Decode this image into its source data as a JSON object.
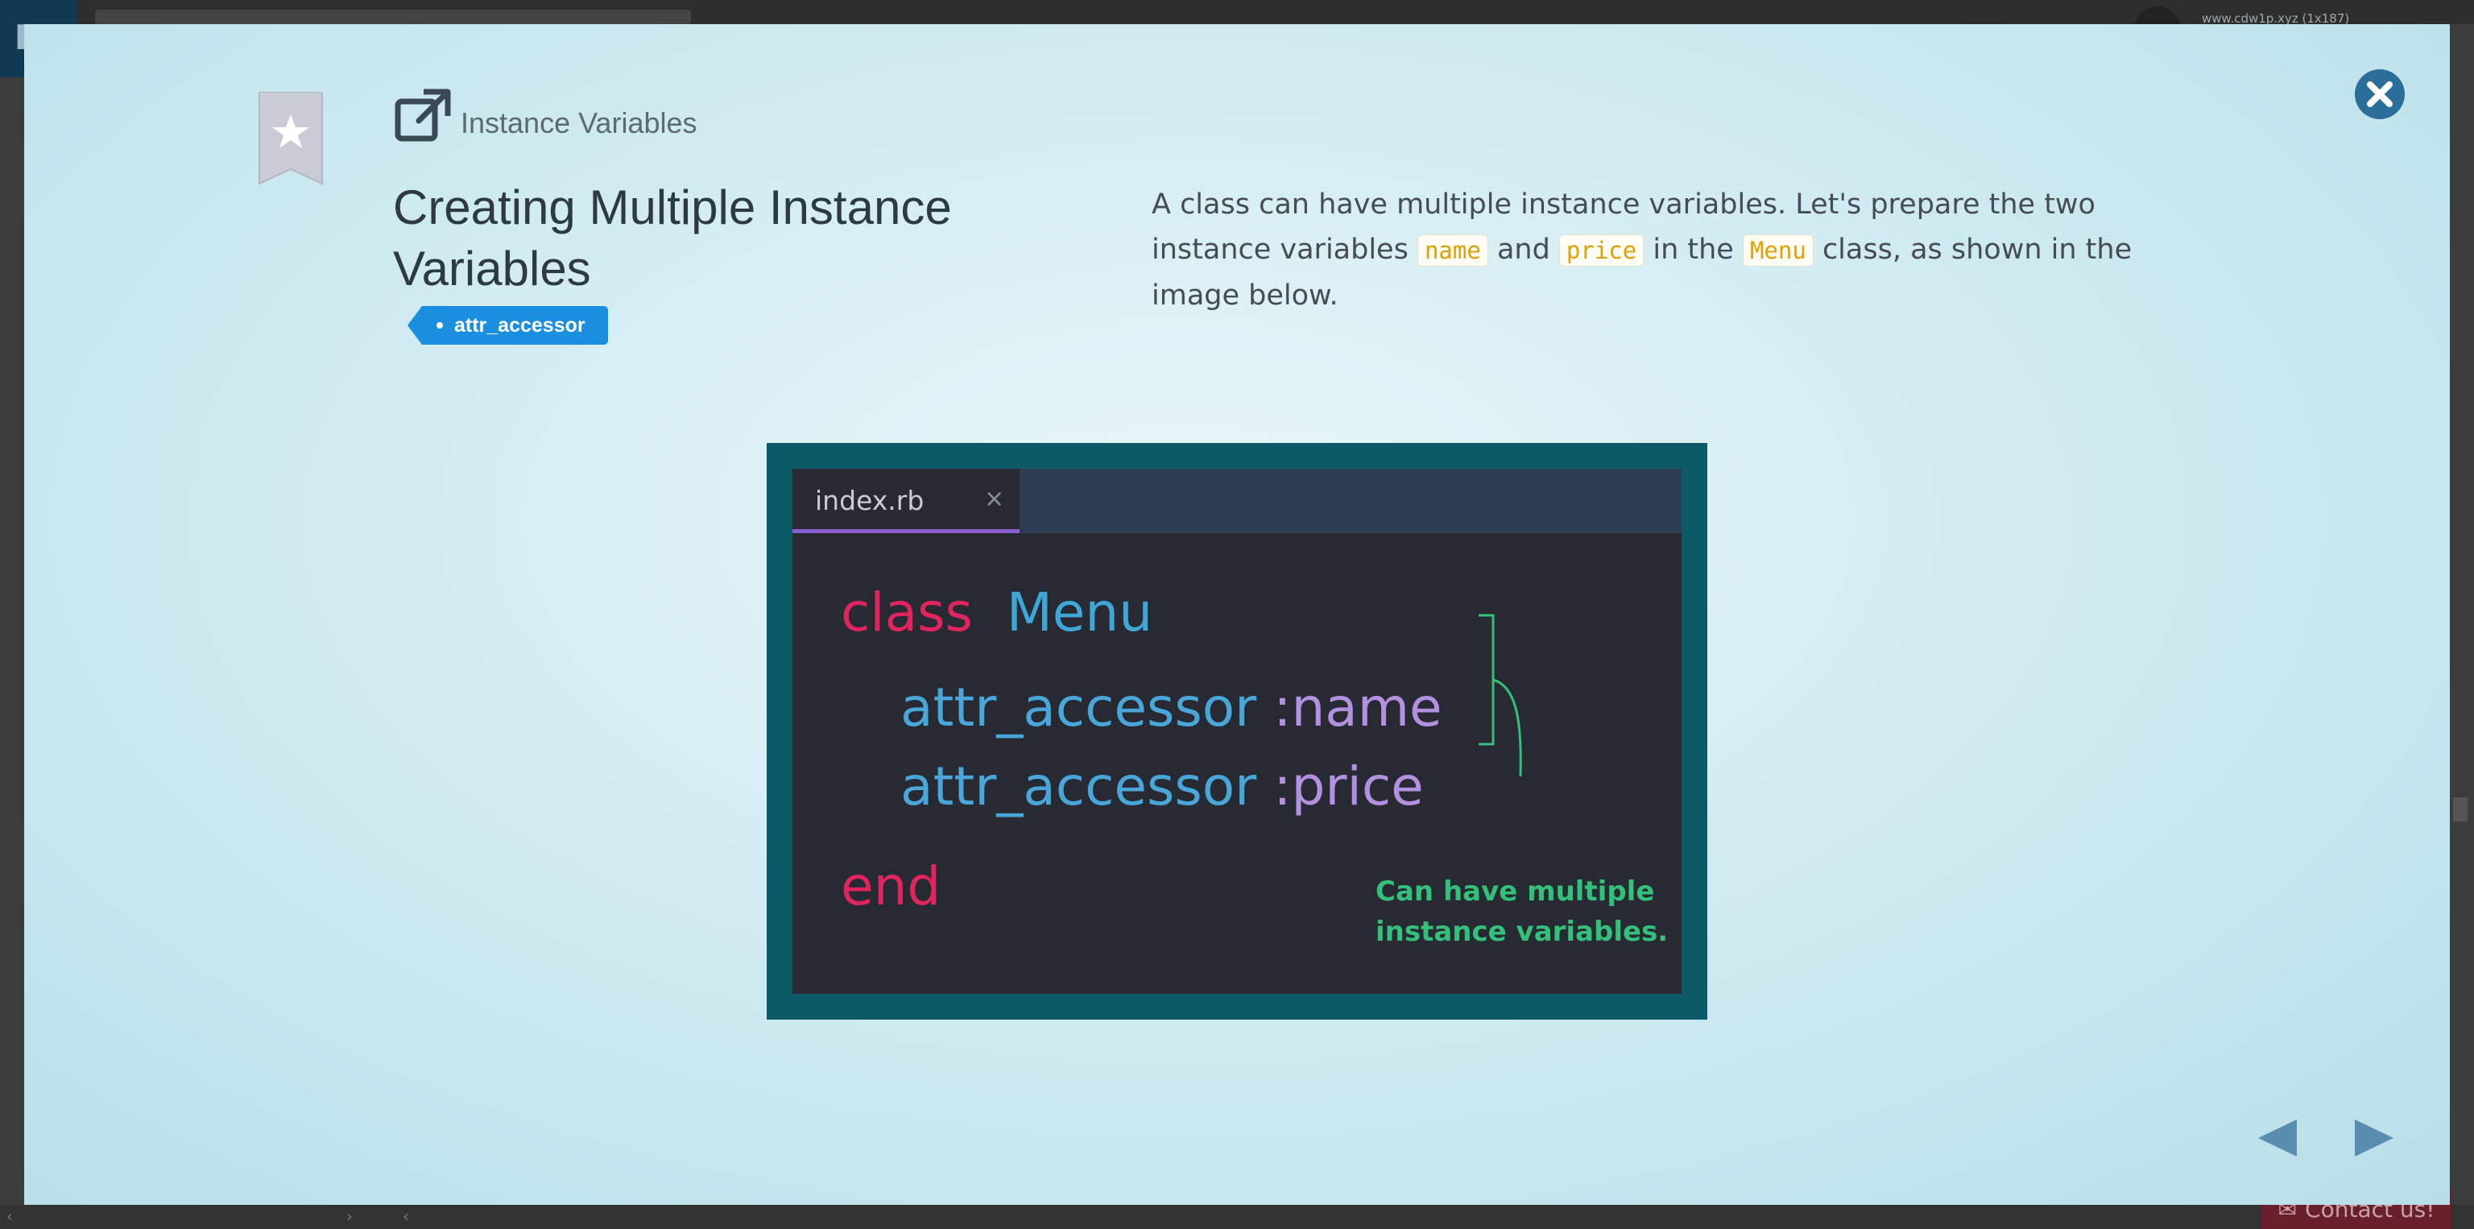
{
  "background": {
    "user_url": "www.cdw1p.xyz (1x187)",
    "contact_label": "Contact us!"
  },
  "modal": {
    "lesson_name": "Instance Variables",
    "title": "Creating Multiple Instance Variables",
    "tag": "attr_accessor",
    "description": {
      "part1": "A class can have multiple instance variables. Let's prepare the two instance variables ",
      "code1": "name",
      "part2": " and ",
      "code2": "price",
      "part3": " in the ",
      "code3": "Menu",
      "part4": " class, as shown in the image below."
    },
    "icons": {
      "bookmark": "bookmark-star-icon",
      "external": "external-link-icon",
      "close": "close-icon",
      "prev": "triangle-left-icon",
      "next": "triangle-right-icon"
    }
  },
  "code_image": {
    "tab_name": "index.rb",
    "tab_close": "×",
    "line1_kw": "class",
    "line1_name": "Menu",
    "line2_method": "attr_accessor",
    "line2_sym": ":name",
    "line3_method": "attr_accessor",
    "line3_sym": ":price",
    "line4_kw": "end",
    "annotation_line1": "Can have multiple",
    "annotation_line2": "instance variables."
  },
  "colors": {
    "accent": "#1a8fe0",
    "close_button": "#2b6e9a",
    "nav_arrow": "#5b8db0",
    "inline_code": "#e0a000",
    "keyword": "#e0245e",
    "class_name": "#3fa7d6",
    "symbol": "#b391e0",
    "annotation": "#33c07a"
  }
}
